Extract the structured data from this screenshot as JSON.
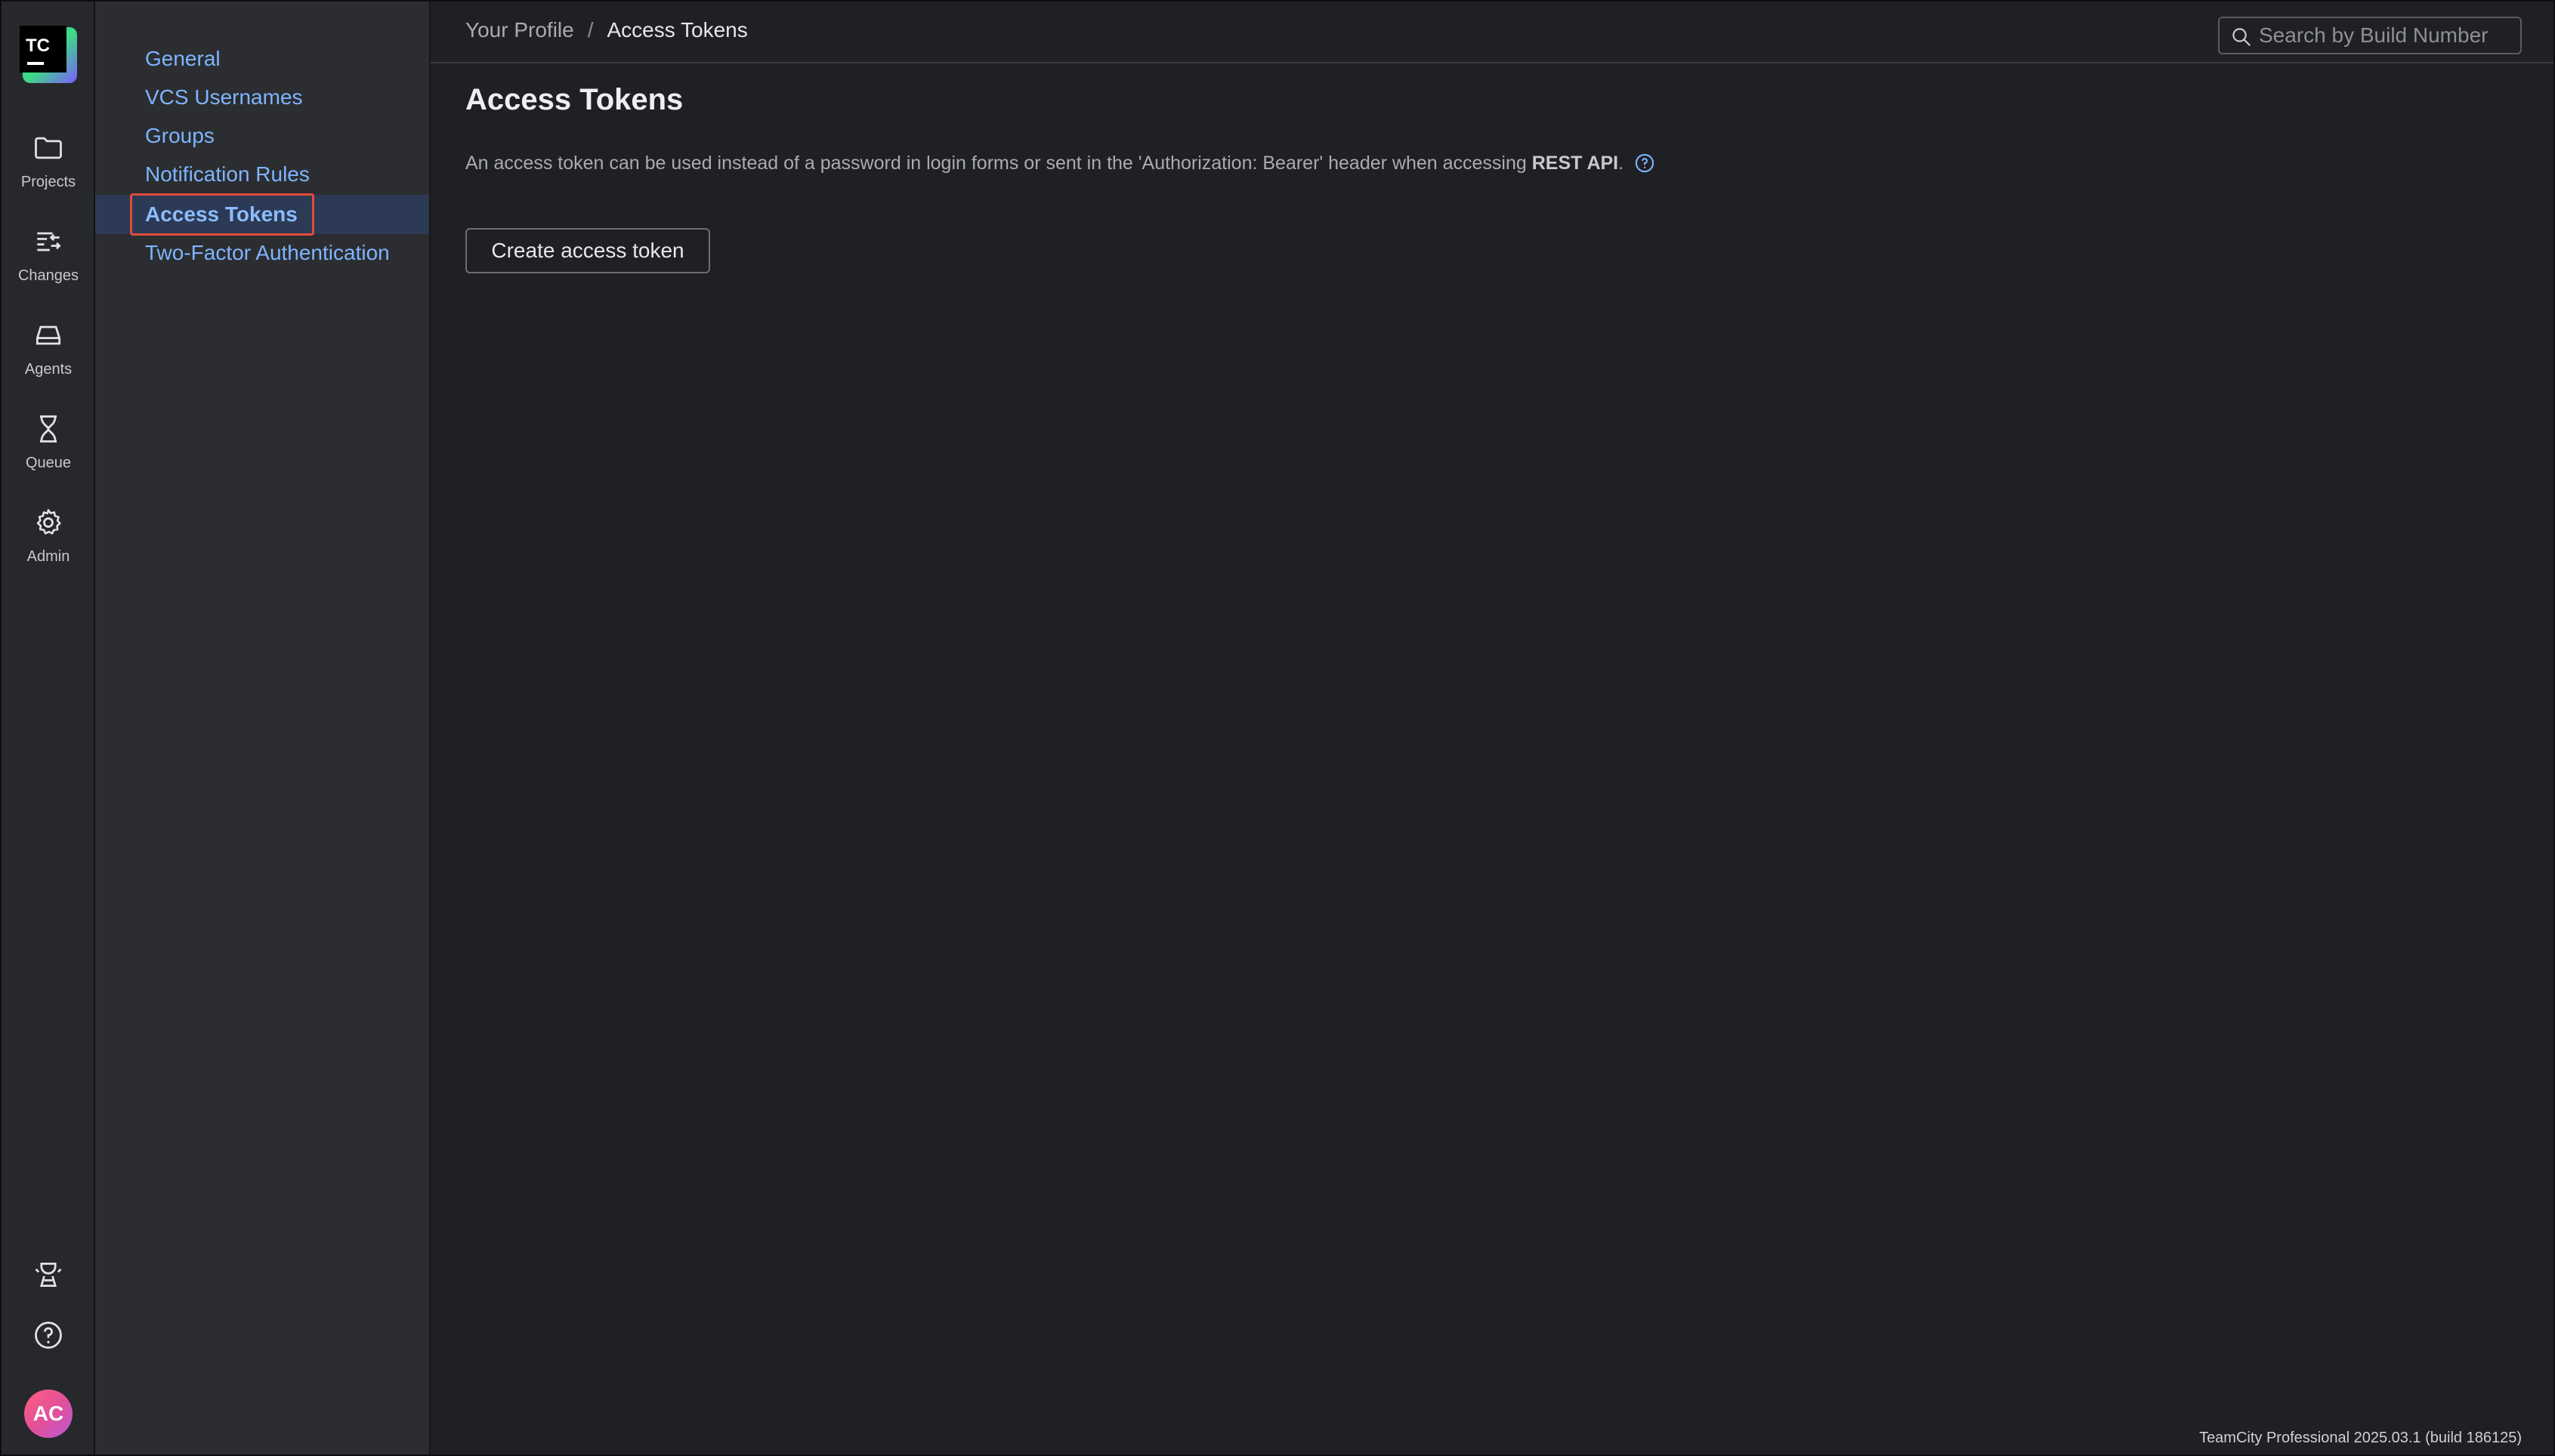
{
  "app": {
    "logo_text": "TC"
  },
  "rail": {
    "items": [
      {
        "label": "Projects",
        "icon": "folder-icon"
      },
      {
        "label": "Changes",
        "icon": "changes-icon"
      },
      {
        "label": "Agents",
        "icon": "agent-icon"
      },
      {
        "label": "Queue",
        "icon": "hourglass-icon"
      },
      {
        "label": "Admin",
        "icon": "gear-icon"
      }
    ],
    "bottom": {
      "whats_new_icon": "trophy-icon",
      "help_icon": "help-circle-icon",
      "avatar_initials": "AC"
    }
  },
  "subnav": {
    "items": [
      {
        "label": "General"
      },
      {
        "label": "VCS Usernames"
      },
      {
        "label": "Groups"
      },
      {
        "label": "Notification Rules"
      },
      {
        "label": "Access Tokens",
        "active": true
      },
      {
        "label": "Two-Factor Authentication"
      }
    ]
  },
  "header": {
    "breadcrumb_parent": "Your Profile",
    "breadcrumb_sep": "/",
    "breadcrumb_current": "Access Tokens",
    "search_placeholder": "Search by Build Number"
  },
  "main": {
    "title": "Access Tokens",
    "description_prefix": "An access token can be used instead of a password in login forms or sent in the 'Authorization: Bearer' header when accessing ",
    "description_bold": "REST API",
    "description_suffix": ".",
    "create_button": "Create access token"
  },
  "footer": {
    "version": "TeamCity Professional 2025.03.1 (build 186125)"
  },
  "colors": {
    "accent_link": "#7fb4ff",
    "active_highlight": "#e24b3b",
    "background": "#1f2023"
  }
}
